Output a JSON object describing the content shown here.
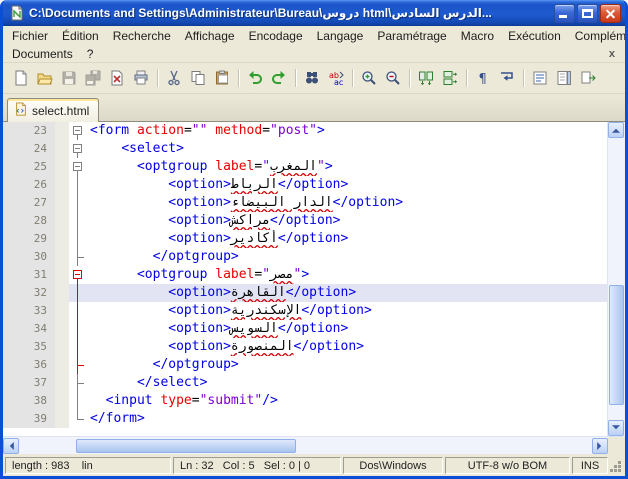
{
  "window": {
    "title": "C:\\Documents and Settings\\Administrateur\\Bureau\\دروس html\\الدرس السادس..."
  },
  "menubar": {
    "row1": [
      "Fichier",
      "Édition",
      "Recherche",
      "Affichage",
      "Encodage",
      "Langage",
      "Paramétrage",
      "Macro",
      "Exécution",
      "Compléments"
    ],
    "row2": [
      "Documents",
      "?"
    ],
    "close_glyph": "x"
  },
  "toolbar": {
    "icons": [
      {
        "name": "new-file-icon",
        "symbol": "new"
      },
      {
        "name": "open-file-icon",
        "symbol": "open"
      },
      {
        "name": "save-icon",
        "symbol": "save",
        "disabled": true
      },
      {
        "name": "save-all-icon",
        "symbol": "saveall",
        "disabled": true
      },
      {
        "name": "close-file-icon",
        "symbol": "closefile"
      },
      {
        "name": "print-icon",
        "symbol": "print"
      },
      {
        "name": "cut-icon",
        "symbol": "cut",
        "sep": true
      },
      {
        "name": "copy-icon",
        "symbol": "copy"
      },
      {
        "name": "paste-icon",
        "symbol": "paste"
      },
      {
        "name": "undo-icon",
        "symbol": "undo",
        "sep": true
      },
      {
        "name": "redo-icon",
        "symbol": "redo"
      },
      {
        "name": "find-icon",
        "symbol": "find",
        "sep": true
      },
      {
        "name": "replace-icon",
        "symbol": "replace"
      },
      {
        "name": "zoom-in-icon",
        "symbol": "zoomin",
        "sep": true
      },
      {
        "name": "zoom-out-icon",
        "symbol": "zoomout"
      },
      {
        "name": "sync-vertical-scroll-icon",
        "symbol": "syncv",
        "sep": true
      },
      {
        "name": "sync-horizontal-scroll-icon",
        "symbol": "synch"
      },
      {
        "name": "show-all-characters-icon",
        "symbol": "para",
        "sep": true
      },
      {
        "name": "word-wrap-icon",
        "symbol": "wrap"
      },
      {
        "name": "function-list-icon",
        "symbol": "funclist",
        "sep": true
      },
      {
        "name": "document-map-icon",
        "symbol": "docmap"
      },
      {
        "name": "doc-switcher-icon",
        "symbol": "docswitch"
      }
    ]
  },
  "tabbar": {
    "tabs": [
      {
        "label": "select.html",
        "active": true
      }
    ]
  },
  "editor": {
    "colors": {
      "tag": "#0000e8",
      "attribute": "#e80000",
      "value": "#7a00d4",
      "text": "#000000",
      "line_number": "#807d72",
      "current_line_bg": "#e2e4f4",
      "fold": "#808080",
      "fold_active": "#e00000",
      "misspelled": "#d00000"
    },
    "lines": [
      {
        "n": 23,
        "fold": "box",
        "indent": 0,
        "tokens": [
          [
            "tag",
            "<form "
          ],
          [
            "attr",
            "action"
          ],
          [
            "op",
            "="
          ],
          [
            "val",
            "\"\""
          ],
          [
            "plain",
            " "
          ],
          [
            "attr",
            "method"
          ],
          [
            "op",
            "="
          ],
          [
            "val",
            "\"post\""
          ],
          [
            "tag",
            ">"
          ]
        ]
      },
      {
        "n": 24,
        "fold": "box",
        "indent": 4,
        "tokens": [
          [
            "tag",
            "<select>"
          ]
        ]
      },
      {
        "n": 25,
        "fold": "box",
        "indent": 6,
        "tokens": [
          [
            "tag",
            "<optgroup "
          ],
          [
            "attr",
            "label"
          ],
          [
            "op",
            "="
          ],
          [
            "val",
            "\""
          ],
          [
            "ar",
            "المغرب"
          ],
          [
            "val",
            "\""
          ],
          [
            "tag",
            ">"
          ]
        ]
      },
      {
        "n": 26,
        "fold": "line",
        "indent": 10,
        "tokens": [
          [
            "tag",
            "<option>"
          ],
          [
            "ar",
            "الرباط"
          ],
          [
            "tag",
            "</option>"
          ]
        ]
      },
      {
        "n": 27,
        "fold": "line",
        "indent": 10,
        "tokens": [
          [
            "tag",
            "<option>"
          ],
          [
            "ar",
            "الدار البيضاء"
          ],
          [
            "tag",
            "</option>"
          ]
        ]
      },
      {
        "n": 28,
        "fold": "line",
        "indent": 10,
        "tokens": [
          [
            "tag",
            "<option>"
          ],
          [
            "ar",
            "مراكش"
          ],
          [
            "tag",
            "</option>"
          ]
        ]
      },
      {
        "n": 29,
        "fold": "line",
        "indent": 10,
        "tokens": [
          [
            "tag",
            "<option>"
          ],
          [
            "ar",
            "أكادير"
          ],
          [
            "tag",
            "</option>"
          ]
        ]
      },
      {
        "n": 30,
        "fold": "tick",
        "indent": 8,
        "tokens": [
          [
            "tag",
            "</optgroup>"
          ]
        ]
      },
      {
        "n": 31,
        "fold": "box",
        "red": true,
        "indent": 6,
        "tokens": [
          [
            "tag",
            "<optgroup "
          ],
          [
            "attr",
            "label"
          ],
          [
            "op",
            "="
          ],
          [
            "val",
            "\""
          ],
          [
            "ar",
            "مصر"
          ],
          [
            "val",
            "\""
          ],
          [
            "tag",
            ">"
          ]
        ]
      },
      {
        "n": 32,
        "fold": "line",
        "red": true,
        "current": true,
        "indent": 10,
        "tokens": [
          [
            "tag",
            "<option>"
          ],
          [
            "ar",
            "القاهرة"
          ],
          [
            "tag",
            "</option>"
          ]
        ]
      },
      {
        "n": 33,
        "fold": "line",
        "red": true,
        "indent": 10,
        "tokens": [
          [
            "tag",
            "<option>"
          ],
          [
            "ar",
            "الإسكندرية"
          ],
          [
            "tag",
            "</option>"
          ]
        ]
      },
      {
        "n": 34,
        "fold": "line",
        "red": true,
        "indent": 10,
        "tokens": [
          [
            "tag",
            "<option>"
          ],
          [
            "ar",
            "السويس"
          ],
          [
            "tag",
            "</option>"
          ]
        ]
      },
      {
        "n": 35,
        "fold": "line",
        "red": true,
        "indent": 10,
        "tokens": [
          [
            "tag",
            "<option>"
          ],
          [
            "ar",
            "المنصورة"
          ],
          [
            "tag",
            "</option>"
          ]
        ]
      },
      {
        "n": 36,
        "fold": "tick",
        "red": true,
        "indent": 8,
        "tokens": [
          [
            "tag",
            "</optgroup>"
          ]
        ]
      },
      {
        "n": 37,
        "fold": "tick",
        "indent": 6,
        "tokens": [
          [
            "tag",
            "</select>"
          ]
        ]
      },
      {
        "n": 38,
        "fold": "line",
        "indent": 2,
        "tokens": [
          [
            "tag",
            "<input "
          ],
          [
            "attr",
            "type"
          ],
          [
            "op",
            "="
          ],
          [
            "val",
            "\"submit\""
          ],
          [
            "tag",
            "/>"
          ]
        ]
      },
      {
        "n": 39,
        "fold": "end",
        "indent": 0,
        "tokens": [
          [
            "tag",
            "</form>"
          ]
        ]
      }
    ]
  },
  "statusbar": {
    "doc_length_panel": "length : 983    lin",
    "cursor_panel": "Ln : 32   Col : 5   Sel : 0 | 0",
    "eol_format": "Dos\\Windows",
    "encoding": "UTF-8 w/o BOM",
    "insert_mode": "INS"
  }
}
